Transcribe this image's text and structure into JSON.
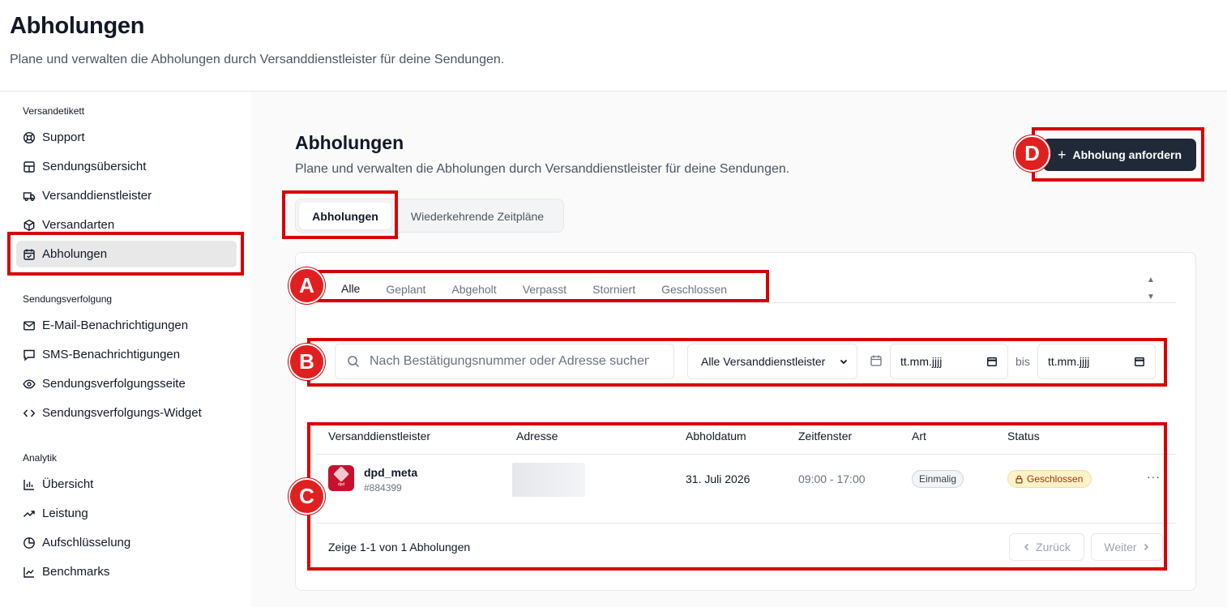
{
  "header": {
    "title": "Abholungen",
    "subtitle": "Plane und verwalten die Abholungen durch Versanddienstleister für deine Sendungen."
  },
  "sidebar": {
    "sections": [
      {
        "title": "Versandetikett",
        "items": [
          {
            "label": "Support",
            "icon": "lifebuoy-icon"
          },
          {
            "label": "Sendungsübersicht",
            "icon": "layout-icon"
          },
          {
            "label": "Versanddienstleister",
            "icon": "truck-icon"
          },
          {
            "label": "Versandarten",
            "icon": "package-icon"
          },
          {
            "label": "Abholungen",
            "icon": "calendar-check-icon",
            "active": true
          }
        ]
      },
      {
        "title": "Sendungsverfolgung",
        "items": [
          {
            "label": "E-Mail-Benachrichtigungen",
            "icon": "mail-icon"
          },
          {
            "label": "SMS-Benachrichtigungen",
            "icon": "message-icon"
          },
          {
            "label": "Sendungsverfolgungsseite",
            "icon": "eye-icon"
          },
          {
            "label": "Sendungsverfolgungs-Widget",
            "icon": "code-icon"
          }
        ]
      },
      {
        "title": "Analytik",
        "items": [
          {
            "label": "Übersicht",
            "icon": "bar-chart-icon"
          },
          {
            "label": "Leistung",
            "icon": "trending-up-icon"
          },
          {
            "label": "Aufschlüsselung",
            "icon": "pie-chart-icon"
          },
          {
            "label": "Benchmarks",
            "icon": "line-chart-icon"
          }
        ]
      }
    ]
  },
  "main": {
    "title": "Abholungen",
    "subtitle": "Plane und verwalten die Abholungen durch Versanddienstleister für deine Sendungen.",
    "primary_button": "Abholung anfordern",
    "tabs": [
      "Abholungen",
      "Wiederkehrende Zeitpläne"
    ],
    "status_tabs": [
      "Alle",
      "Geplant",
      "Abgeholt",
      "Verpasst",
      "Storniert",
      "Geschlossen"
    ],
    "filters": {
      "search_placeholder": "Nach Bestätigungsnummer oder Adresse suchen",
      "carrier_select": "Alle Versanddienstleister",
      "date_from": "tt.mm.jjjj",
      "date_to": "tt.mm.jjjj",
      "bis": "bis"
    },
    "table": {
      "columns": [
        "Versanddienstleister",
        "Adresse",
        "Abholdatum",
        "Zeitfenster",
        "Art",
        "Status"
      ],
      "rows": [
        {
          "carrier": "dpd_meta",
          "logo_text": "dpd",
          "confirmation": "#884399",
          "date": "31. Juli 2026",
          "time": "09:00 - 17:00",
          "type": "Einmalig",
          "status": "Geschlossen",
          "menu": "···"
        }
      ]
    },
    "pagination": {
      "summary": "Zeige 1-1 von 1 Abholungen",
      "prev": "Zurück",
      "next": "Weiter"
    }
  },
  "annotations": [
    "A",
    "B",
    "C",
    "D"
  ],
  "colors": {
    "annotation": "#d80000",
    "primary": "#1f2937",
    "status_closed_bg": "#fef3c7"
  }
}
